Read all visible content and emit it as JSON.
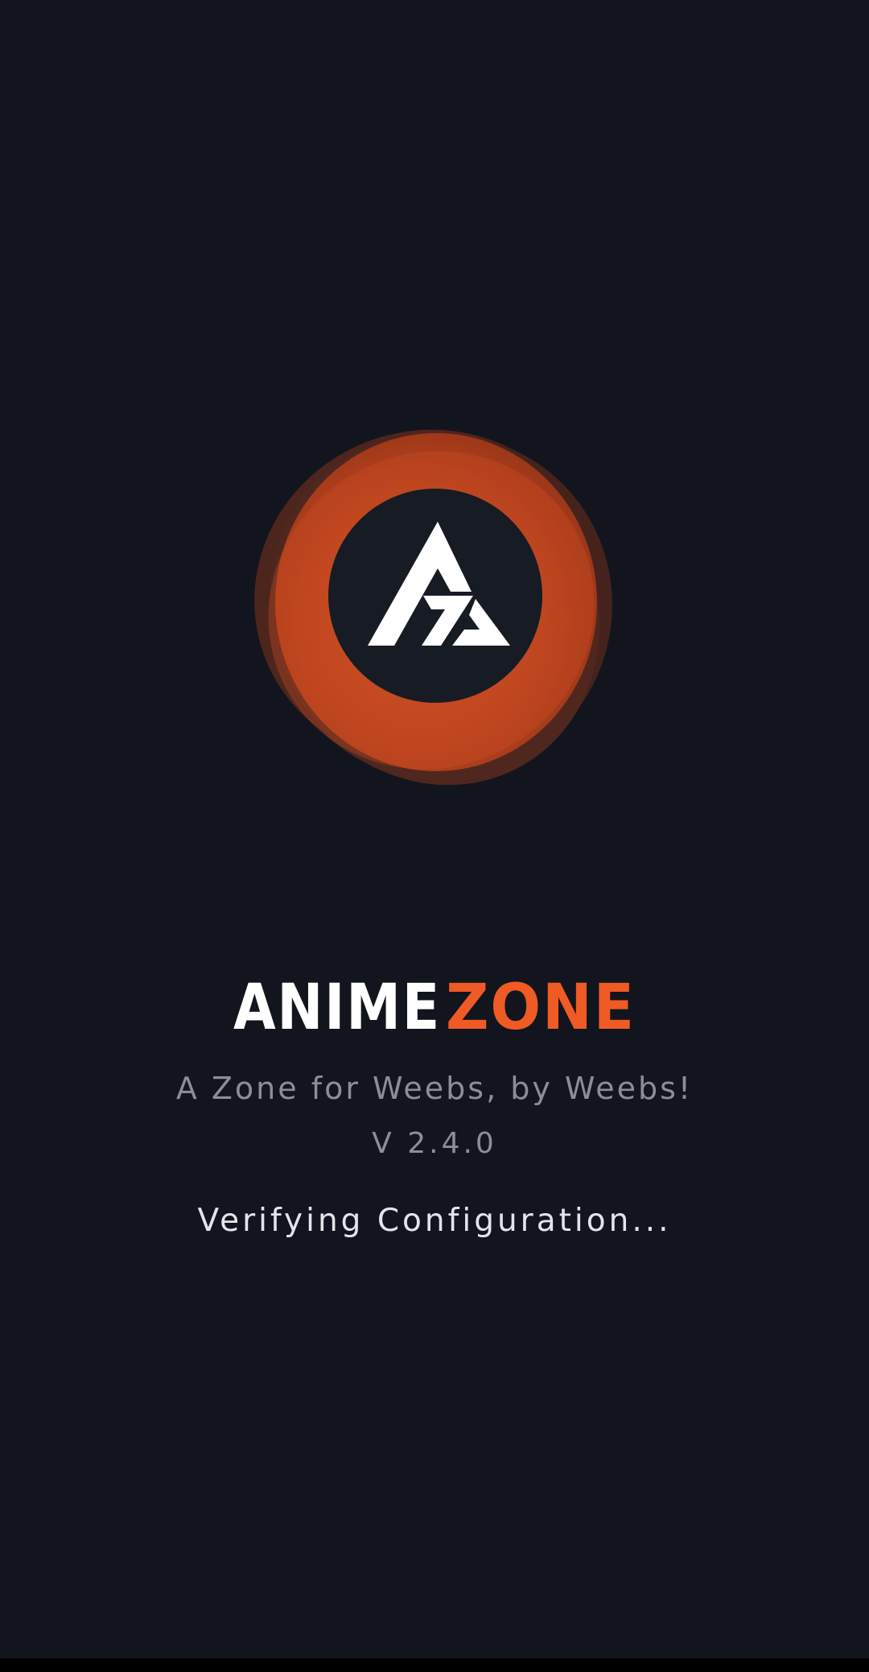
{
  "splash": {
    "wordmark": {
      "part1": "ANIME",
      "part2": "ZONE"
    },
    "tagline": "A Zone for Weebs, by Weebs!",
    "version": "V 2.4.0",
    "status": "Verifying Configuration..."
  },
  "colors": {
    "background": "#12151d",
    "accent": "#f05a24",
    "logo_ring": "#c8441c",
    "text_white": "#ffffff",
    "text_muted": "#8b8e96"
  },
  "icons": {
    "logo": "animezone-triangle-logo-icon"
  }
}
